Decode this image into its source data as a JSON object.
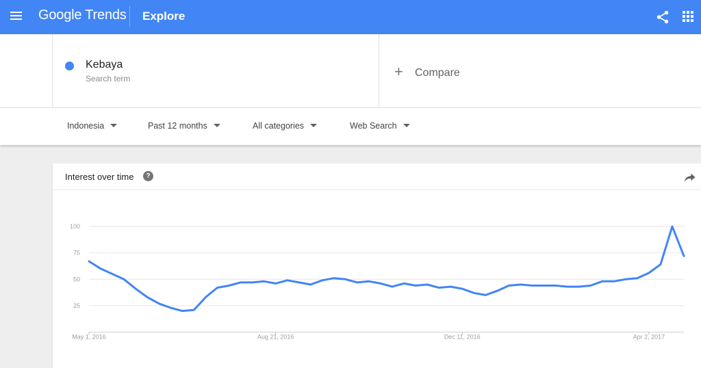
{
  "app": {
    "logo": "Google Trends",
    "page_title": "Explore"
  },
  "search_term": {
    "name": "Kebaya",
    "type": "Search term",
    "color": "#4285f4"
  },
  "compare": {
    "plus": "+",
    "label": "Compare"
  },
  "filters": {
    "region": "Indonesia",
    "time_range": "Past 12 months",
    "category": "All categories",
    "property": "Web Search"
  },
  "card": {
    "title": "Interest over time",
    "help": "?"
  },
  "chart_data": {
    "type": "line",
    "title": "Interest over time",
    "ylim": [
      0,
      100
    ],
    "y_ticks": [
      25,
      50,
      75,
      100
    ],
    "x_tick_labels": [
      "May 1, 2016",
      "Aug 21, 2016",
      "Dec 11, 2016",
      "Apr 2, 2017"
    ],
    "grid": true,
    "series": [
      {
        "name": "Kebaya",
        "color": "#4285f4",
        "values": [
          67,
          60,
          55,
          50,
          41,
          33,
          27,
          23,
          20,
          21,
          33,
          42,
          44,
          47,
          47,
          48,
          46,
          49,
          47,
          45,
          49,
          51,
          50,
          47,
          48,
          46,
          43,
          46,
          44,
          45,
          42,
          43,
          41,
          37,
          35,
          39,
          44,
          45,
          44,
          44,
          44,
          43,
          43,
          44,
          48,
          48,
          50,
          51,
          56,
          64,
          100,
          72
        ]
      }
    ]
  }
}
